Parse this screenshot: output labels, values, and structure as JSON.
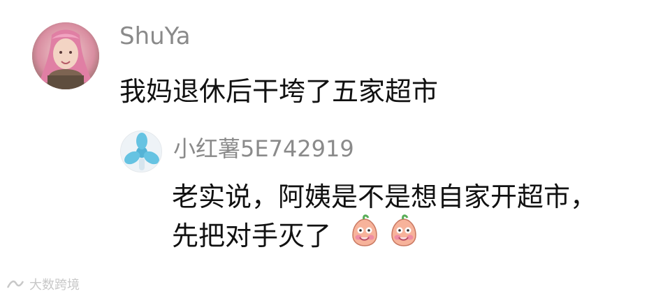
{
  "comment": {
    "username": "ShuYa",
    "text": "我妈退休后干垮了五家超市"
  },
  "reply": {
    "username": "小红薯5E742919",
    "text_line1": "老实说，阿姨是不是想自家开超市，",
    "text_line2": "先把对手灭了",
    "emoji_count": 2
  },
  "watermark": {
    "text": "大数跨境"
  }
}
